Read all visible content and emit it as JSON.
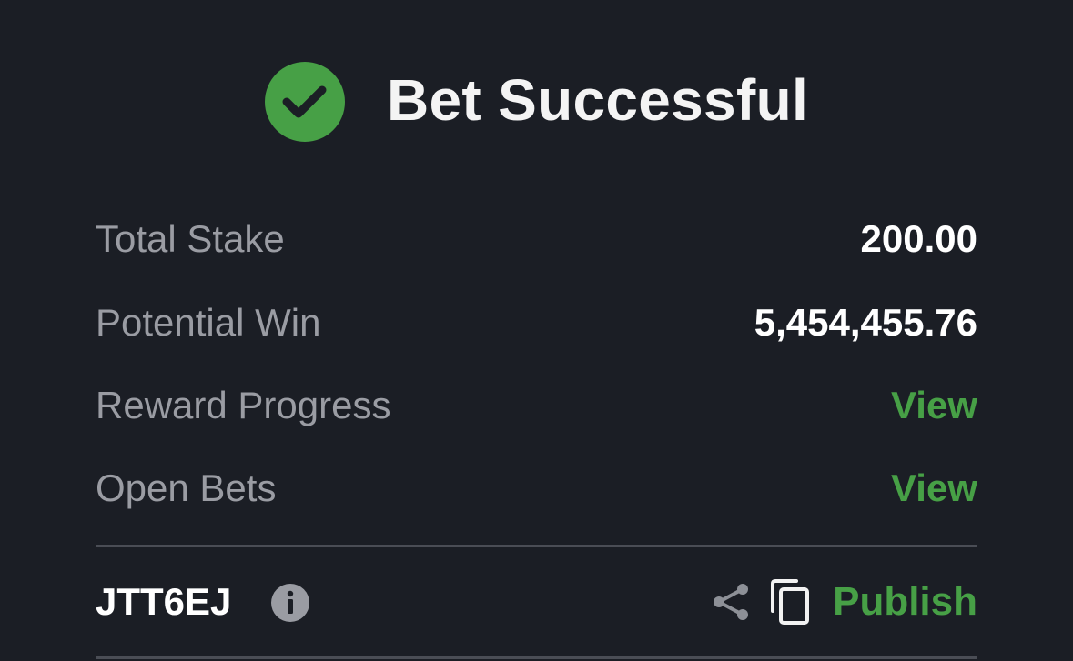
{
  "header": {
    "title": "Bet Successful",
    "icon": "check-circle-icon"
  },
  "summary": [
    {
      "label": "Total Stake",
      "value": "200.00"
    },
    {
      "label": "Potential Win",
      "value": "5,454,455.76"
    },
    {
      "label": "Reward Progress",
      "link": "View"
    },
    {
      "label": "Open Bets",
      "link": "View"
    }
  ],
  "footer": {
    "booking_code": "JTT6EJ",
    "info_icon": "info-icon",
    "share_icon": "share-icon",
    "copy_icon": "copy-icon",
    "publish_label": "Publish"
  },
  "colors": {
    "background": "#1b1e25",
    "accent_green": "#47a046",
    "label_gray": "#9a9ca3",
    "value_white": "#ffffff",
    "divider": "#4a4d55"
  }
}
